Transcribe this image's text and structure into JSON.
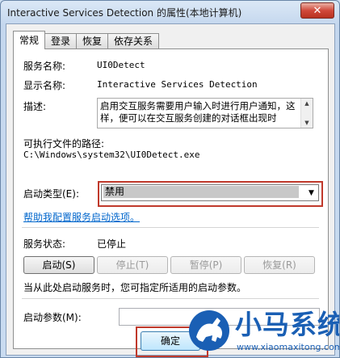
{
  "window": {
    "title": "Interactive Services Detection 的属性(本地计算机)",
    "close_glyph": "✕"
  },
  "tabs": [
    {
      "label": "常规",
      "active": true
    },
    {
      "label": "登录",
      "active": false
    },
    {
      "label": "恢复",
      "active": false
    },
    {
      "label": "依存关系",
      "active": false
    }
  ],
  "general": {
    "service_name_label": "服务名称:",
    "service_name_value": "UI0Detect",
    "display_name_label": "显示名称:",
    "display_name_value": "Interactive Services Detection",
    "description_label": "描述:",
    "description_value": "启用交互服务需要用户输入时进行用户通知，这样，便可以在交互服务创建的对话框出现时",
    "exe_path_label": "可执行文件的路径:",
    "exe_path_value": "C:\\Windows\\system32\\UI0Detect.exe",
    "startup_type_label": "启动类型(E):",
    "startup_type_value": "禁用",
    "help_link": "帮助我配置服务启动选项。",
    "status_label": "服务状态:",
    "status_value": "已停止",
    "buttons": {
      "start": "启动(S)",
      "stop": "停止(T)",
      "pause": "暂停(P)",
      "resume": "恢复(R)"
    },
    "start_hint": "当从此处启动服务时，您可指定所适用的启动参数。",
    "start_params_label": "启动参数(M):",
    "start_params_value": ""
  },
  "footer": {
    "ok_label": "确定"
  },
  "watermark": {
    "brand": "小马系统",
    "url": "www.xiaomaxitong.com"
  },
  "colors": {
    "highlight": "#c0392b",
    "link": "#0066cc",
    "brand_blue": "#1a5fb4"
  }
}
